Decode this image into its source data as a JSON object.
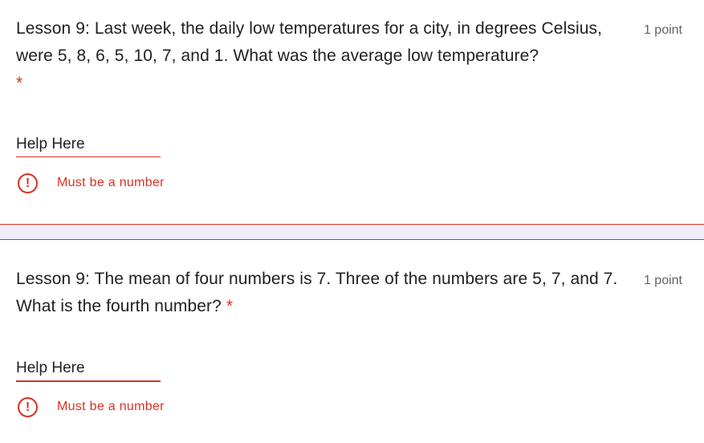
{
  "questions": [
    {
      "text": "Lesson 9: Last week, the daily low temperatures for a city, in degrees Celsius, were 5, 8, 6, 5, 10, 7, and 1. What was the average low temperature?",
      "required_marker": "*",
      "points": "1 point",
      "answer_value": "Help Here",
      "error_text": "Must be a number",
      "error_icon": "!"
    },
    {
      "text": "Lesson 9: The mean of four numbers is 7. Three of the numbers are 5, 7, and 7. What is the fourth number?",
      "required_marker": "*",
      "points": "1 point",
      "answer_value": "Help Here",
      "error_text": "Must be a number",
      "error_icon": "!"
    }
  ],
  "colors": {
    "error_red": "#d93025",
    "divider_band": "#f0ebf8",
    "text": "#202124",
    "muted": "#5f6368"
  }
}
